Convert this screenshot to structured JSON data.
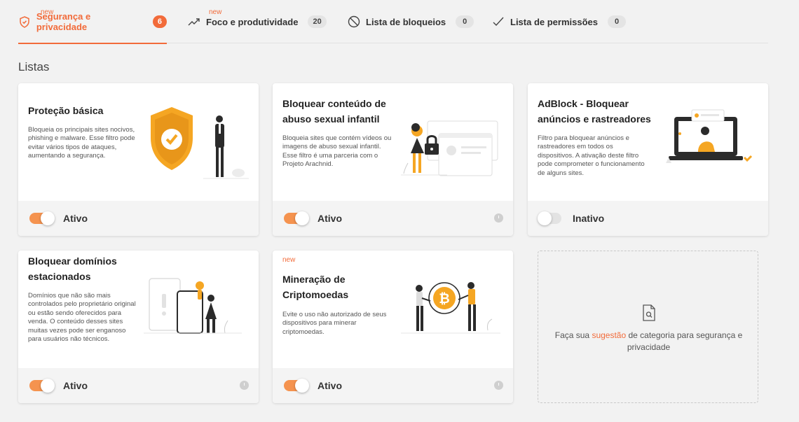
{
  "tabs": [
    {
      "new": "new",
      "label": "Segurança e privacidade",
      "count": "6",
      "icon": "shield-check-icon"
    },
    {
      "new": "new",
      "label": "Foco e produtividade",
      "count": "20",
      "icon": "trend-up-icon"
    },
    {
      "label": "Lista de bloqueios",
      "count": "0",
      "icon": "block-icon"
    },
    {
      "label": "Lista de permissões",
      "count": "0",
      "icon": "check-icon"
    }
  ],
  "section_title": "Listas",
  "cards": [
    {
      "title": "Proteção básica",
      "desc": "Bloqueia os principais sites nocivos, phishing e malware. Esse filtro pode evitar vários tipos de ataques, aumentando a segurança.",
      "state": "Ativo"
    },
    {
      "title": "Bloquear conteúdo de abuso sexual infantil",
      "desc": "Bloqueia sites que contém vídeos ou imagens de abuso sexual infantil. Esse filtro é uma parceria com o Projeto Arachnid.",
      "state": "Ativo"
    },
    {
      "title": "AdBlock - Bloquear anúncios e rastreadores",
      "desc": "Filtro para bloquear anúncios e rastreadores em todos os dispositivos. A ativação deste filtro pode comprometer o funcionamento de alguns sites.",
      "state": "Inativo"
    },
    {
      "title": "Bloquear domínios estacionados",
      "desc": "Domínios que não são mais controlados pelo proprietário original ou estão sendo oferecidos para venda. O conteúdo desses sites muitas vezes pode ser enganoso para usuários não técnicos.",
      "state": "Ativo"
    },
    {
      "new": "new",
      "title": "Mineração de Criptomoedas",
      "desc": "Evite o uso não autorizado de seus dispositivos para minerar criptomoedas.",
      "state": "Ativo"
    }
  ],
  "suggest": {
    "before": "Faça sua ",
    "link": "sugestão",
    "after": " de categoria para segurança e privacidade"
  },
  "colors": {
    "accent": "#f26b3a",
    "toggle_on": "#f5934f",
    "illustration": "#f5a623"
  }
}
